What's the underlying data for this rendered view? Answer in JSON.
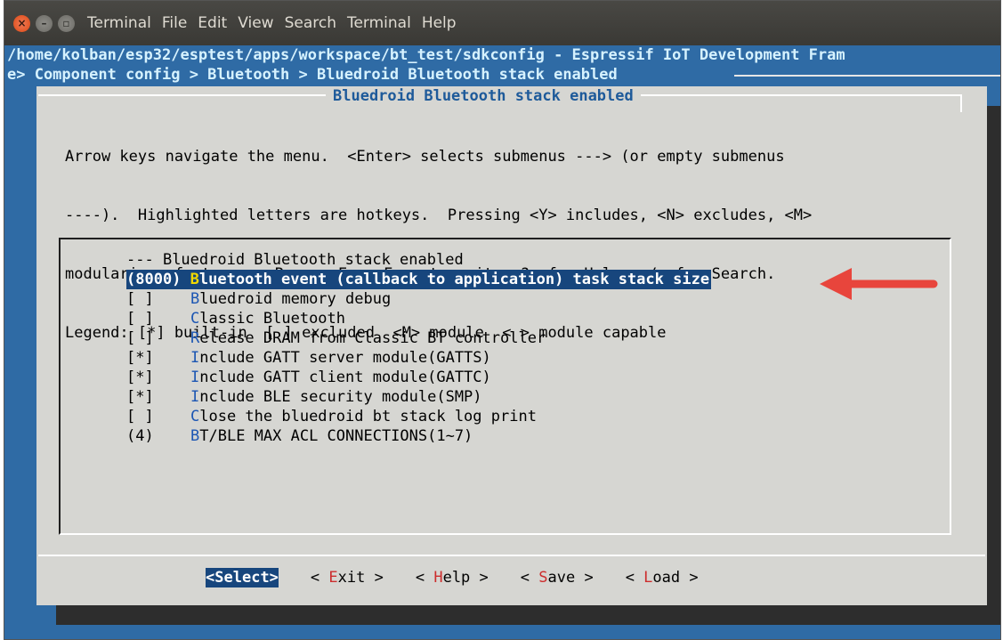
{
  "titlebar": {
    "menu": [
      "Terminal",
      "File",
      "Edit",
      "View",
      "Search",
      "Terminal",
      "Help"
    ]
  },
  "terminal": {
    "path_line": "/home/kolban/esp32/esptest/apps/workspace/bt_test/sdkconfig - Espressif IoT Development Fram",
    "breadcrumb_line": "e> Component config > Bluetooth > Bluedroid Bluetooth stack enabled"
  },
  "dialog": {
    "title": "Bluedroid Bluetooth stack enabled",
    "instructions": [
      "Arrow keys navigate the menu.  <Enter> selects submenus ---> (or empty submenus",
      "----).  Highlighted letters are hotkeys.  Pressing <Y> includes, <N> excludes, <M>",
      "modularizes features.  Press <Esc><Esc> to exit, <?> for Help, </> for Search.",
      "Legend: [*] built-in  [ ] excluded  <M> module  < > module capable"
    ],
    "menu_items": [
      {
        "prefix": "--- ",
        "hotkey": "",
        "rest": "Bluedroid Bluetooth stack enabled"
      },
      {
        "prefix": "(8000) ",
        "hotkey": "B",
        "rest": "luetooth event (callback to application) task stack size"
      },
      {
        "prefix": "[ ]",
        "hotkey": "B",
        "rest": "luedroid memory debug"
      },
      {
        "prefix": "[ ]",
        "hotkey": "C",
        "rest": "lassic Bluetooth"
      },
      {
        "prefix": "[ ]",
        "hotkey": "R",
        "rest": "elease DRAM from Classic BT controller"
      },
      {
        "prefix": "[*]",
        "hotkey": "I",
        "rest": "nclude GATT server module(GATTS)"
      },
      {
        "prefix": "[*]",
        "hotkey": "I",
        "rest": "nclude GATT client module(GATTC)"
      },
      {
        "prefix": "[*]",
        "hotkey": "I",
        "rest": "nclude BLE security module(SMP)"
      },
      {
        "prefix": "[ ]",
        "hotkey": "C",
        "rest": "lose the bluedroid bt stack log print"
      },
      {
        "prefix": "(4)",
        "hotkey": "B",
        "rest": "T/BLE MAX ACL CONNECTIONS(1~7)"
      }
    ],
    "buttons": [
      {
        "pre": "<",
        "hotkey": "S",
        "post": "elect>"
      },
      {
        "pre": "< ",
        "hotkey": "E",
        "post": "xit >"
      },
      {
        "pre": "< ",
        "hotkey": "H",
        "post": "elp >"
      },
      {
        "pre": "< ",
        "hotkey": "S",
        "post": "ave >"
      },
      {
        "pre": "< ",
        "hotkey": "L",
        "post": "oad >"
      }
    ]
  },
  "colors": {
    "terminal_bg": "#2f6ba5",
    "dialog_bg": "#d6d6d2",
    "selection": "#17467d",
    "annotation_arrow": "#e8453c"
  },
  "icons": [
    "close-icon",
    "minimize-icon",
    "maximize-icon",
    "annotation-arrow-icon"
  ]
}
